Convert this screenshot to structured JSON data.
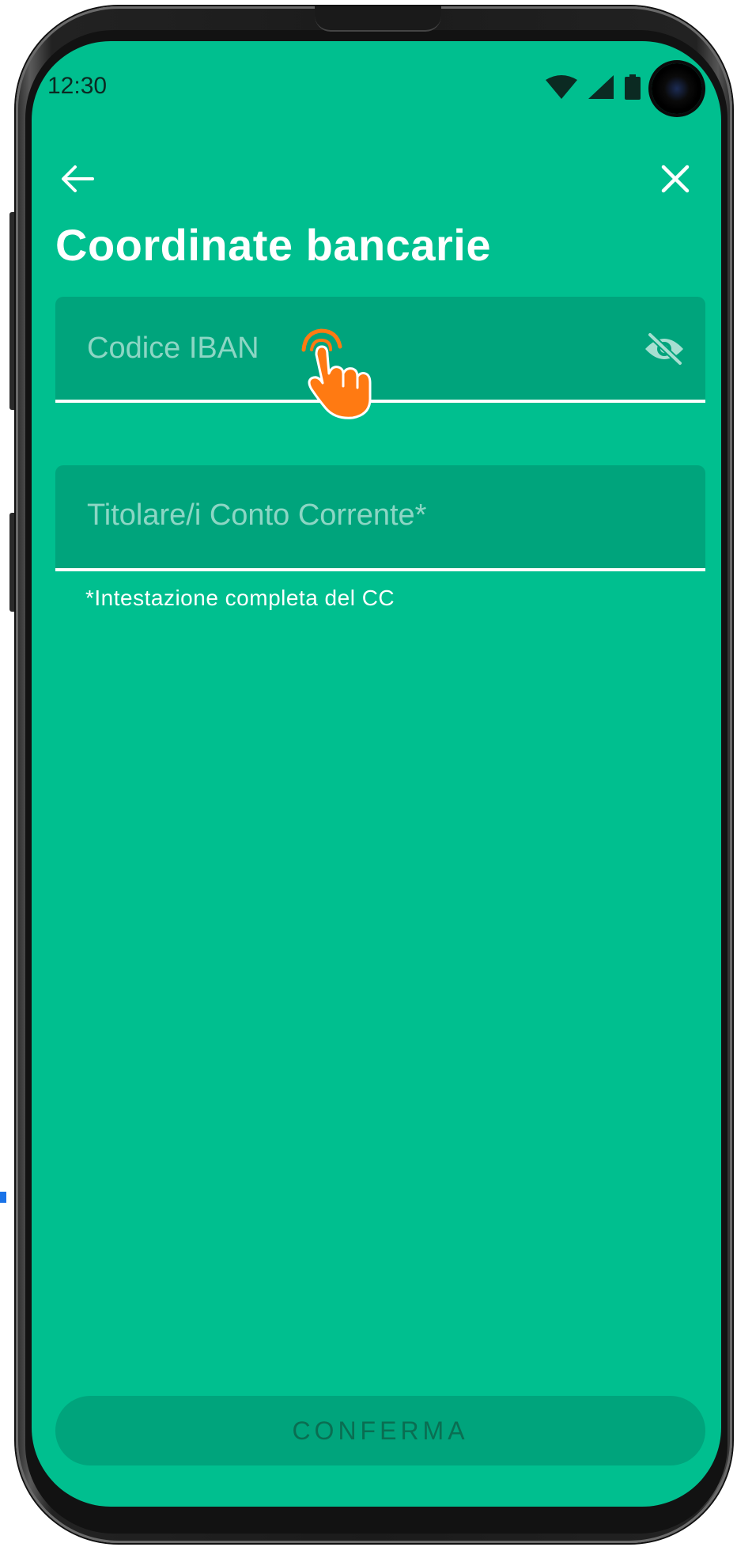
{
  "status_bar": {
    "time": "12:30",
    "icons": [
      "wifi-icon",
      "signal-icon",
      "battery-icon"
    ]
  },
  "navigation": {
    "back_icon": "arrow-left-icon",
    "close_icon": "close-icon"
  },
  "page": {
    "title": "Coordinate bancarie"
  },
  "form": {
    "iban": {
      "placeholder": "Codice IBAN",
      "value": "",
      "toggle_icon": "eye-off-icon"
    },
    "account_holder": {
      "placeholder": "Titolare/i Conto Corrente*",
      "value": "",
      "helper": "*Intestazione completa del CC"
    }
  },
  "actions": {
    "confirm_label": "CONFERMA"
  },
  "colors": {
    "screen_background": "#00bf8f",
    "field_background": "#00a47c",
    "text_primary": "#ffffff",
    "cursor_hand": "#ff7a12"
  }
}
